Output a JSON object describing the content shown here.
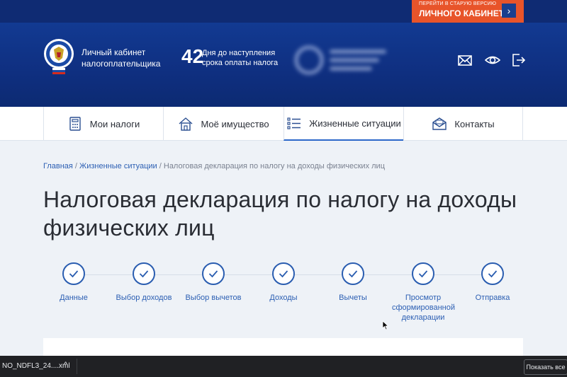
{
  "top": {
    "old_version_line1": "ПЕРЕЙТИ В СТАРУЮ ВЕРСИЮ",
    "old_version_line2": "ЛИЧНОГО КАБИНЕТА",
    "arrow": "›"
  },
  "header": {
    "brand_line1": "Личный кабинет",
    "brand_line2": "налогоплательщика",
    "deadline_days": "42",
    "deadline_line1": "Дня до наступления",
    "deadline_line2": "срока оплаты налога"
  },
  "nav": {
    "items": [
      {
        "label": "Мои налоги",
        "icon": "calculator-icon"
      },
      {
        "label": "Моё имущество",
        "icon": "house-icon"
      },
      {
        "label": "Жизненные ситуации",
        "icon": "list-icon",
        "active": true
      },
      {
        "label": "Контакты",
        "icon": "envelope-icon"
      }
    ]
  },
  "breadcrumb": {
    "home": "Главная",
    "sep": " / ",
    "life": "Жизненные ситуации",
    "current": "Налоговая декларация по налогу на доходы физических лиц"
  },
  "page": {
    "title": "Налоговая декларация по налогу на доходы физических лиц"
  },
  "steps": [
    {
      "label": "Данные"
    },
    {
      "label": "Выбор доходов"
    },
    {
      "label": "Выбор вычетов"
    },
    {
      "label": "Доходы"
    },
    {
      "label": "Вычеты"
    },
    {
      "label": "Просмотр сформированной декларации"
    },
    {
      "label": "Отправка"
    }
  ],
  "download": {
    "filename": "NO_NDFL3_24....xml",
    "chevron": "^",
    "show_all": "Показать все"
  },
  "colors": {
    "header_blue": "#0f2f80",
    "accent_orange": "#e8542a",
    "link_blue": "#2c5fb3"
  }
}
